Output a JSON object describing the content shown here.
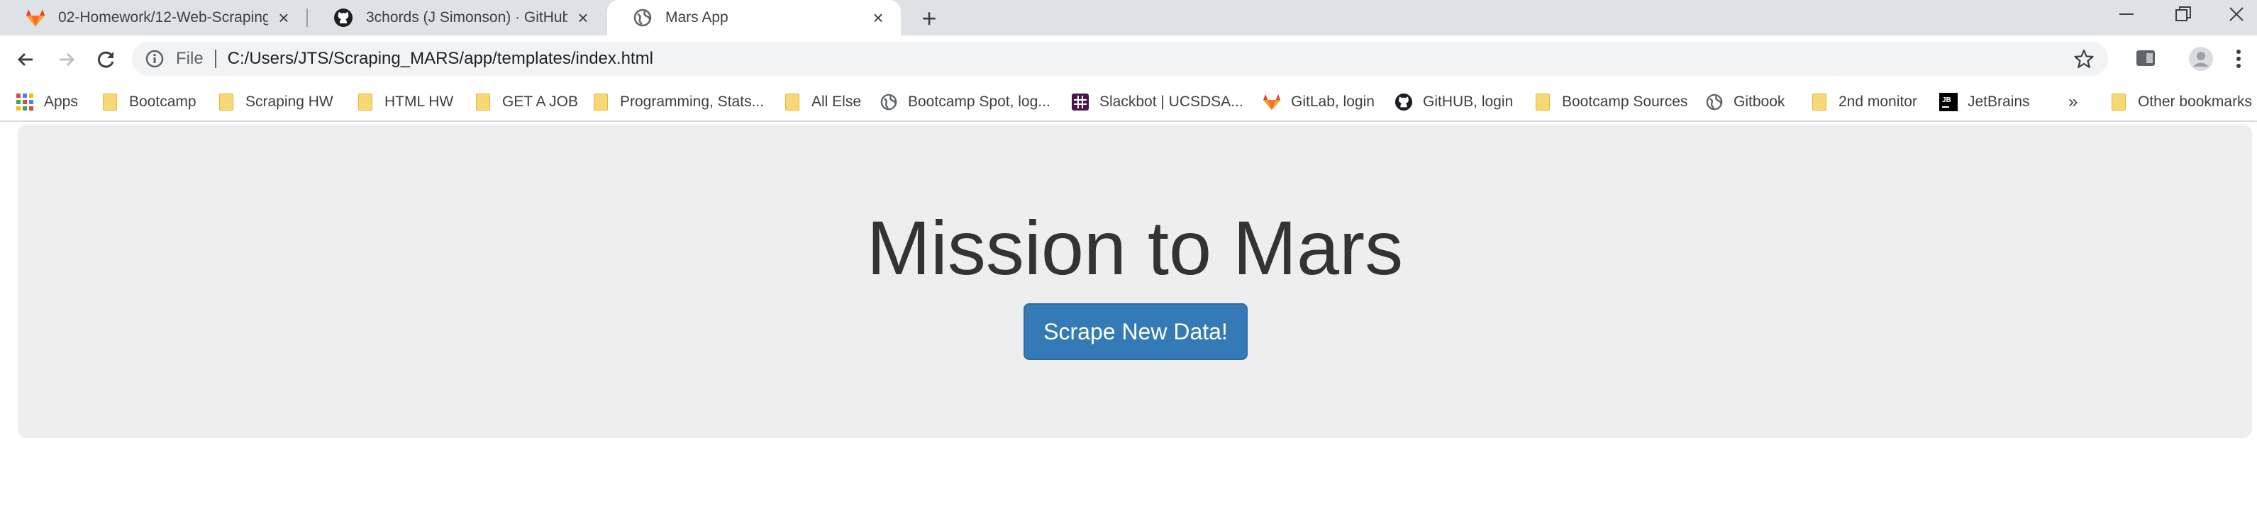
{
  "browser": {
    "tabs": [
      {
        "title": "02-Homework/12-Web-Scraping",
        "favicon": "gitlab-icon",
        "active": false
      },
      {
        "title": "3chords (J Simonson) · GitHub",
        "favicon": "github-icon",
        "active": false
      },
      {
        "title": "Mars App",
        "favicon": "globe-icon",
        "active": true
      }
    ],
    "address": {
      "scheme_label": "File",
      "url": "C:/Users/JTS/Scraping_MARS/app/templates/index.html"
    },
    "bookmarks": [
      {
        "label": "Apps",
        "icon": "apps-grid-icon"
      },
      {
        "label": "Bootcamp",
        "icon": "folder-icon"
      },
      {
        "label": "Scraping HW",
        "icon": "folder-icon"
      },
      {
        "label": "HTML HW",
        "icon": "folder-icon"
      },
      {
        "label": "GET A JOB",
        "icon": "folder-icon"
      },
      {
        "label": "Programming, Stats...",
        "icon": "folder-icon"
      },
      {
        "label": "All Else",
        "icon": "folder-icon"
      },
      {
        "label": "Bootcamp Spot, log...",
        "icon": "globe-icon"
      },
      {
        "label": "Slackbot | UCSDSA...",
        "icon": "slack-icon"
      },
      {
        "label": "GitLab, login",
        "icon": "gitlab-icon"
      },
      {
        "label": "GitHUB, login",
        "icon": "github-icon"
      },
      {
        "label": "Bootcamp Sources",
        "icon": "folder-icon"
      },
      {
        "label": "Gitbook",
        "icon": "globe-icon"
      },
      {
        "label": "2nd monitor",
        "icon": "folder-icon"
      },
      {
        "label": "JetBrains",
        "icon": "jetbrains-icon"
      }
    ],
    "overflow_label": "»",
    "other_bookmarks_label": "Other bookmarks"
  },
  "page": {
    "title": "Mission to Mars",
    "scrape_button_label": "Scrape New Data!"
  },
  "colors": {
    "button_primary": "#337ab7",
    "jumbotron_bg": "#eeeeee",
    "tabstrip_bg": "#dee1e6"
  }
}
